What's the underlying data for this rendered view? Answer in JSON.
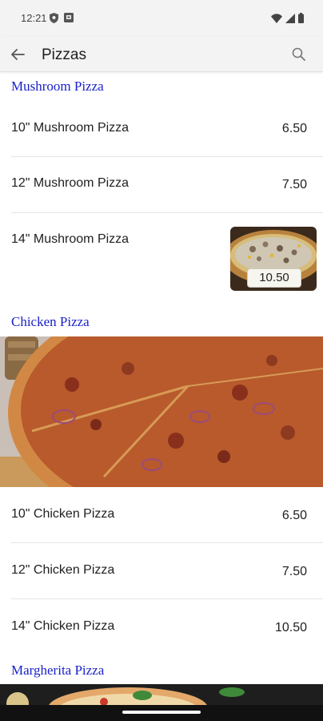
{
  "status_bar": {
    "time": "12:21",
    "left_icons": [
      "shield-icon",
      "notification-box-icon"
    ],
    "right_icons": [
      "wifi-icon",
      "signal-icon",
      "battery-icon"
    ]
  },
  "app_bar": {
    "title": "Pizzas",
    "back_icon": "arrow-left-icon",
    "search_icon": "search-icon"
  },
  "colors": {
    "section_title": "#1a22c8",
    "status_bar_bg": "#f3f3f3",
    "divider": "#e6e6e6"
  },
  "sections": [
    {
      "title": "Mushroom Pizza",
      "items": [
        {
          "name": "10\" Mushroom Pizza",
          "price": "6.50"
        },
        {
          "name": "12\" Mushroom Pizza",
          "price": "7.50"
        },
        {
          "name": "14\" Mushroom Pizza",
          "price": "10.50",
          "has_image": true
        }
      ]
    },
    {
      "title": "Chicken Pizza",
      "banner": "chicken-pizza-photo",
      "items": [
        {
          "name": "10\" Chicken Pizza",
          "price": "6.50"
        },
        {
          "name": "12\" Chicken Pizza",
          "price": "7.50"
        },
        {
          "name": "14\" Chicken Pizza",
          "price": "10.50"
        }
      ]
    },
    {
      "title": "Margherita Pizza",
      "banner": "margherita-pizza-photo"
    }
  ]
}
